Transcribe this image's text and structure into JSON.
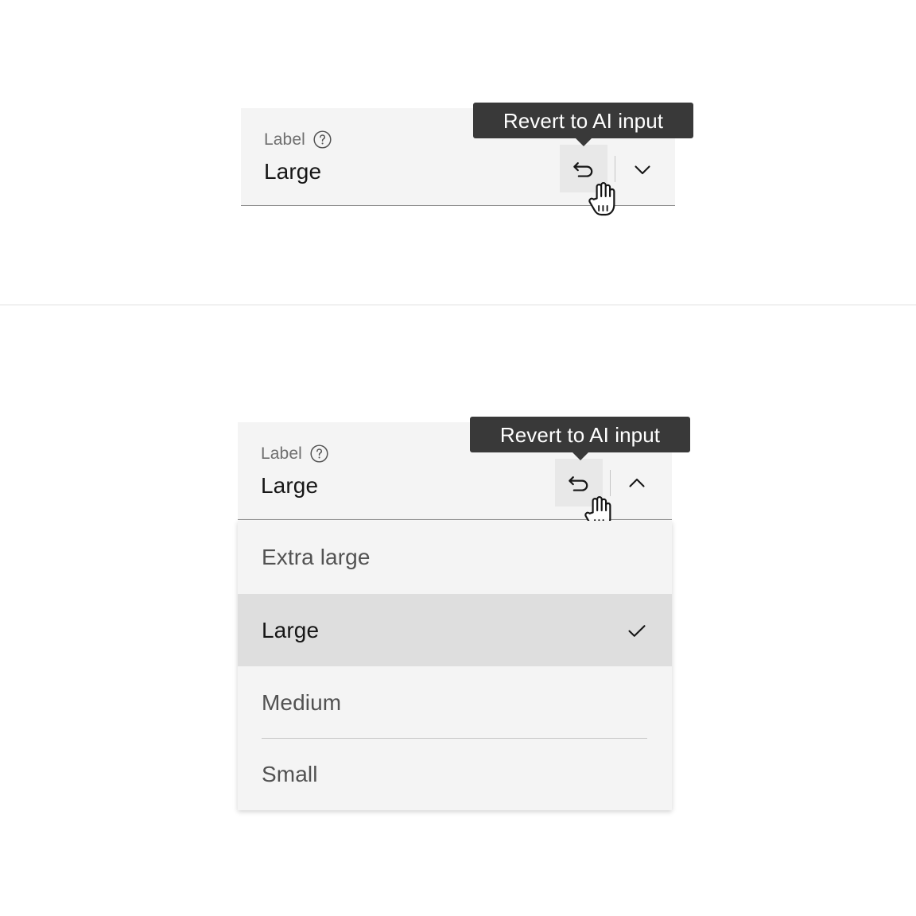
{
  "page": {
    "background_color": "#ffffff",
    "divider_color": "#e0e0e0"
  },
  "colors": {
    "field_background": "#f4f4f4",
    "field_border": "#8d8d8d",
    "revert_hover_background": "#e8e8e8",
    "tooltip_background": "#393939",
    "tooltip_text": "#ffffff",
    "selected_option_background": "#dedede",
    "label_text": "#6f6f6f",
    "value_text": "#161616",
    "option_text": "#525252",
    "rule": "#c6c6c6"
  },
  "variants": [
    {
      "id": "closed",
      "label": "Label",
      "help_icon": "help-circle-icon",
      "value": "Large",
      "revert_icon": "undo-revert-icon",
      "revert_tooltip": "Revert to AI input",
      "chevron_icon": "chevron-down-icon",
      "expanded": false
    },
    {
      "id": "open",
      "label": "Label",
      "help_icon": "help-circle-icon",
      "value": "Large",
      "revert_icon": "undo-revert-icon",
      "revert_tooltip": "Revert to AI input",
      "chevron_icon": "chevron-up-icon",
      "expanded": true,
      "options": [
        {
          "label": "Extra large",
          "selected": false,
          "rule_below": false
        },
        {
          "label": "Large",
          "selected": true,
          "rule_below": false
        },
        {
          "label": "Medium",
          "selected": false,
          "rule_below": true
        },
        {
          "label": "Small",
          "selected": false,
          "rule_below": false
        }
      ]
    }
  ]
}
